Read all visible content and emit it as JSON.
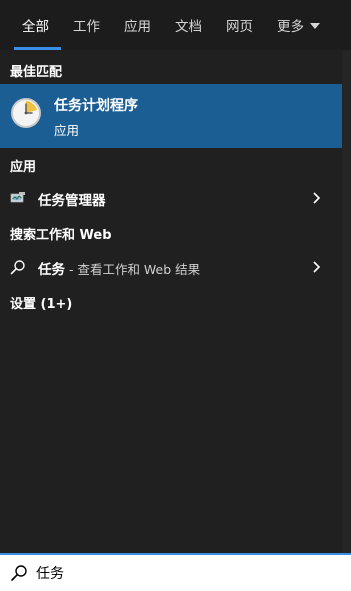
{
  "tabs": [
    {
      "label": "全部",
      "active": true
    },
    {
      "label": "工作",
      "active": false
    },
    {
      "label": "应用",
      "active": false
    },
    {
      "label": "文档",
      "active": false
    },
    {
      "label": "网页",
      "active": false
    },
    {
      "label": "更多",
      "active": false
    }
  ],
  "best_match": {
    "title": "最佳匹配",
    "name": "任务计划程序",
    "type": "应用",
    "icon": "task-scheduler-clock-icon"
  },
  "apps_section": {
    "title": "应用",
    "items": [
      {
        "label": "任务管理器",
        "icon": "task-manager-icon"
      }
    ]
  },
  "web_section": {
    "title": "搜索工作和 Web",
    "items": [
      {
        "query": "任务",
        "suffix": " - 查看工作和 Web 结果",
        "icon": "search-icon"
      }
    ]
  },
  "settings_section": {
    "title": "设置 (1+)"
  },
  "search": {
    "value": "任务",
    "icon": "search-icon"
  },
  "colors": {
    "accent": "#3b8ee8",
    "selected_bg": "#1b5e93",
    "panel_bg": "#202020"
  }
}
